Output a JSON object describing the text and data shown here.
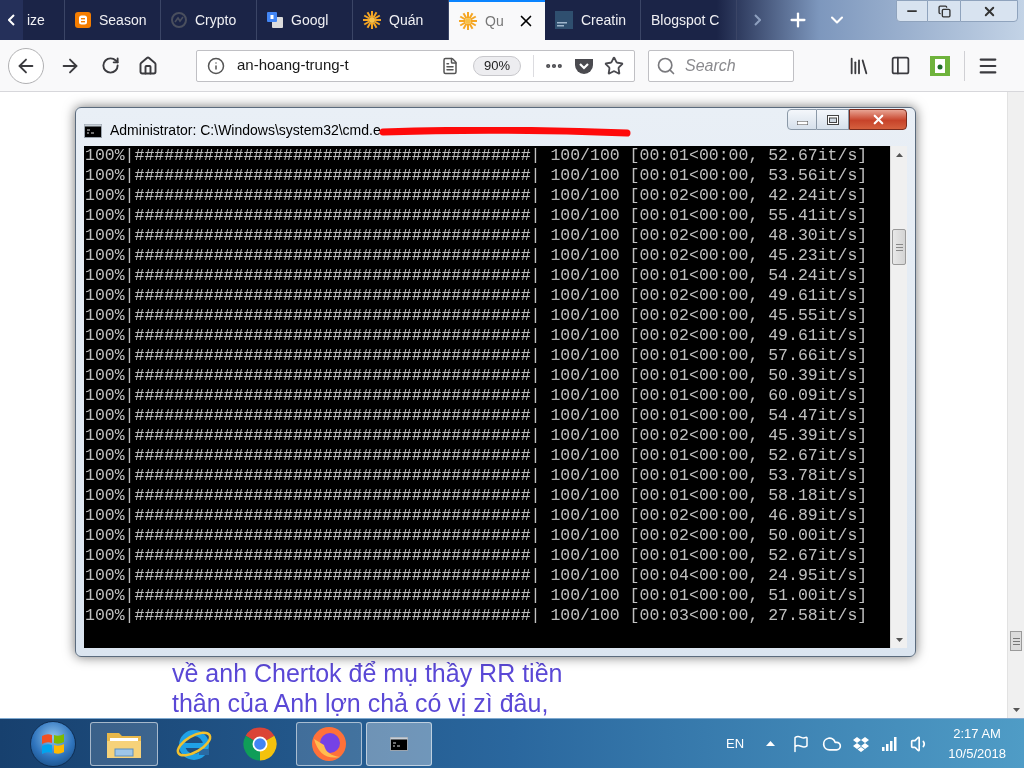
{
  "browser": {
    "tabs": [
      {
        "label": "ize",
        "selected": false
      },
      {
        "label": "Season",
        "selected": false
      },
      {
        "label": "Crypto",
        "selected": false
      },
      {
        "label": "Googl",
        "selected": false
      },
      {
        "label": "Quán",
        "selected": false
      },
      {
        "label": "Qu",
        "selected": true
      },
      {
        "label": "Creatin",
        "selected": false
      },
      {
        "label": "Blogspot C",
        "selected": false
      }
    ],
    "url": "an-hoang-trung-t",
    "zoom": "90%",
    "search": {
      "placeholder": "Search"
    }
  },
  "page": {
    "lines": [
      "về anh Chertok để mụ thầy RR tiền",
      "thân của Anh lợn chả có vị zì đâu,"
    ]
  },
  "cmd_window": {
    "title": "Administrator: C:\\Windows\\system32\\cmd.e",
    "lines": [
      "100%|########################################| 100/100 [00:01<00:00, 52.67it/s]",
      "100%|########################################| 100/100 [00:01<00:00, 53.56it/s]",
      "100%|########################################| 100/100 [00:02<00:00, 42.24it/s]",
      "100%|########################################| 100/100 [00:01<00:00, 55.41it/s]",
      "100%|########################################| 100/100 [00:02<00:00, 48.30it/s]",
      "100%|########################################| 100/100 [00:02<00:00, 45.23it/s]",
      "100%|########################################| 100/100 [00:01<00:00, 54.24it/s]",
      "100%|########################################| 100/100 [00:02<00:00, 49.61it/s]",
      "100%|########################################| 100/100 [00:02<00:00, 45.55it/s]",
      "100%|########################################| 100/100 [00:02<00:00, 49.61it/s]",
      "100%|########################################| 100/100 [00:01<00:00, 57.66it/s]",
      "100%|########################################| 100/100 [00:01<00:00, 50.39it/s]",
      "100%|########################################| 100/100 [00:01<00:00, 60.09it/s]",
      "100%|########################################| 100/100 [00:01<00:00, 54.47it/s]",
      "100%|########################################| 100/100 [00:02<00:00, 45.39it/s]",
      "100%|########################################| 100/100 [00:01<00:00, 52.67it/s]",
      "100%|########################################| 100/100 [00:01<00:00, 53.78it/s]",
      "100%|########################################| 100/100 [00:01<00:00, 58.18it/s]",
      "100%|########################################| 100/100 [00:02<00:00, 46.89it/s]",
      "100%|########################################| 100/100 [00:02<00:00, 50.00it/s]",
      "100%|########################################| 100/100 [00:01<00:00, 52.67it/s]",
      "100%|########################################| 100/100 [00:04<00:00, 24.95it/s]",
      "100%|########################################| 100/100 [00:01<00:00, 51.00it/s]",
      "100%|########################################| 100/100 [00:03<00:00, 27.58it/s]"
    ]
  },
  "taskbar": {
    "apps": [
      {
        "running": true,
        "selected": false
      },
      {
        "running": false,
        "selected": false
      },
      {
        "running": false,
        "selected": false
      },
      {
        "running": true,
        "selected": false
      },
      {
        "running": true,
        "selected": true
      }
    ],
    "language": "EN",
    "time": "2:17 AM",
    "date": "10/5/2018"
  }
}
